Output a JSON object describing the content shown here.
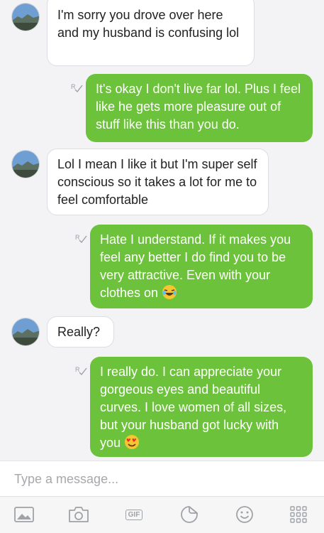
{
  "messages": [
    {
      "direction": "in",
      "text": "I'm sorry you drove over here and my husband is confusing lol"
    },
    {
      "direction": "out",
      "text": "It's okay I don't live far lol. Plus I feel like he gets more pleasure out of stuff like this than you do."
    },
    {
      "direction": "in",
      "text": "Lol I mean I like it but I'm super self conscious so it takes a lot for me to feel comfortable"
    },
    {
      "direction": "out",
      "text": "Hate I understand. If it makes you feel any better I do find you to be very attractive. Even with your clothes on",
      "emoji": "laughing-emoji"
    },
    {
      "direction": "in",
      "text": "Really?"
    },
    {
      "direction": "out",
      "text": "I really do. I can appreciate your gorgeous eyes and beautiful curves. I love women of all sizes, but your husband got lucky with you",
      "emoji": "heart-eyes-emoji"
    }
  ],
  "composer": {
    "placeholder": "Type a message..."
  },
  "toolbar": {
    "gif_label": "GIF",
    "icons": [
      "image-icon",
      "camera-icon",
      "gif-icon",
      "sticker-icon",
      "emoji-icon",
      "apps-grid-icon"
    ]
  },
  "colors": {
    "outgoing_bubble": "#6cc23a",
    "incoming_bubble": "#ffffff",
    "background": "#f3f3f5"
  }
}
